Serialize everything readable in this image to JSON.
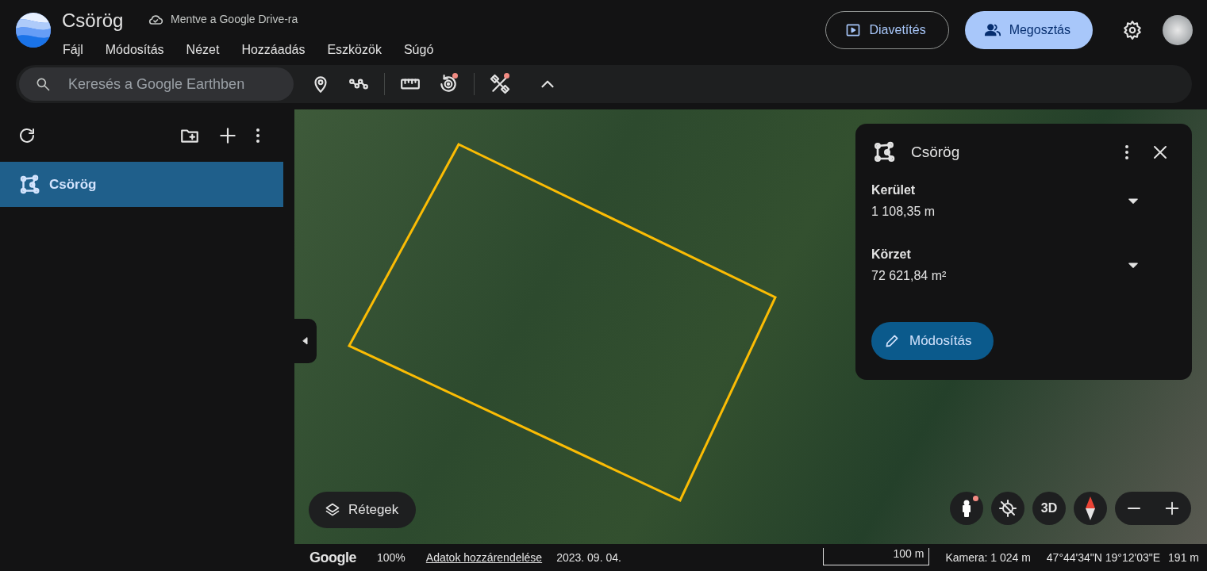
{
  "app": {
    "title": "Csörög",
    "save_status": "Mentve a Google Drive-ra"
  },
  "menu": [
    "Fájl",
    "Módosítás",
    "Nézet",
    "Hozzáadás",
    "Eszközök",
    "Súgó"
  ],
  "header_buttons": {
    "slideshow": "Diavetítés",
    "share": "Megosztás"
  },
  "search": {
    "placeholder": "Keresés a Google Earthben"
  },
  "toolbar": [
    {
      "kind": "pin",
      "badge": false
    },
    {
      "kind": "path",
      "badge": false
    },
    {
      "kind": "ruler",
      "badge": false
    },
    {
      "kind": "history",
      "badge": true
    },
    {
      "kind": "satellite",
      "badge": true
    },
    {
      "kind": "collapse",
      "badge": false
    }
  ],
  "sidebar": {
    "items": [
      {
        "label": "Csörög",
        "selected": true
      }
    ]
  },
  "info_card": {
    "title": "Csörög",
    "metrics": [
      {
        "label": "Kerület",
        "value": "1 108,35 m"
      },
      {
        "label": "Körzet",
        "value": "72 621,84 m²"
      }
    ],
    "edit_button": "Módosítás"
  },
  "map_controls": {
    "layers_button": "Rétegek",
    "pegman_badge": true,
    "three_d": "3D"
  },
  "status_bar": {
    "logo": "Google",
    "zoom": "100%",
    "attribution": "Adatok hozzárendelése",
    "date": "2023. 09. 04.",
    "scale": "100 m",
    "camera": "Kamera: 1 024 m",
    "coordinates": "47°44'34\"N 19°12'03\"E",
    "elevation": "191 m"
  }
}
